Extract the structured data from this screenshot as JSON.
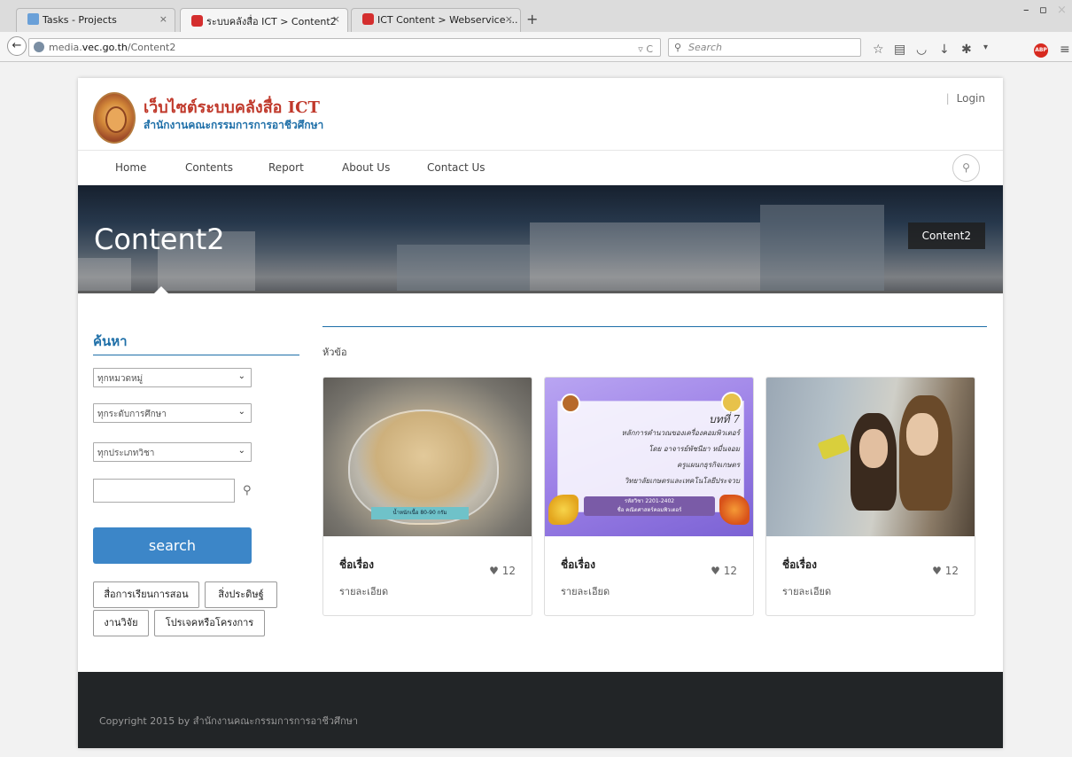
{
  "browser": {
    "tabs": [
      {
        "title": "Tasks - Projects"
      },
      {
        "title": "ระบบคลังสื่อ ICT > Content2"
      },
      {
        "title": "ICT Content > Webservice ..."
      }
    ],
    "url_prefix": "media.",
    "url_domain": "vec.go.th",
    "url_path": "/Content2",
    "search_placeholder": "Search",
    "abp_label": "ABP"
  },
  "site": {
    "title": "เว็บไซต์ระบบคลังสื่อ ICT",
    "subtitle": "สำนักงานคณะกรรมการการอาชีวศึกษา",
    "login": "Login",
    "menu": [
      "Home",
      "Contents",
      "Report",
      "About Us",
      "Contact Us"
    ],
    "hero_title": "Content2",
    "breadcrumb": "Content2"
  },
  "sidebar": {
    "title": "ค้นหา",
    "selects": [
      "ทุกหมวดหมู่",
      "ทุกระดับการศึกษา",
      "ทุกประเภทวิชา"
    ],
    "search_button": "search",
    "tags": [
      "สื่อการเรียนการสอน",
      "สิ่งประดิษฐ์",
      "งานวิจัย",
      "โปรเจคหรือโครงการ"
    ]
  },
  "content": {
    "label": "หัวข้อ",
    "cards": [
      {
        "title": "ชื่อเรื่อง",
        "likes": "12",
        "desc": "รายละเอียด",
        "image": "bowl-photo",
        "image_text": "น้ำหนักเนื้อ 80-90 กรัม"
      },
      {
        "title": "ชื่อเรื่อง",
        "likes": "12",
        "desc": "รายละเอียด",
        "image": "lesson-slide",
        "slide": {
          "chapter": "บทที่ 7",
          "line1": "หลักการคำนวณของเครื่องคอมพิวเตอร์",
          "line2": "โดย อาจารย์พัชนียา หมื่นจอม",
          "line3": "ครูแผนกธุรกิจเกษตร",
          "line4": "วิทยาลัยเกษตรและเทคโนโลยีประจวบ",
          "bar1": "รหัสวิชา 2201-2402",
          "bar2": "ชื่อ คณิตศาสตร์คอมพิวเตอร์"
        }
      },
      {
        "title": "ชื่อเรื่อง",
        "likes": "12",
        "desc": "รายละเอียด",
        "image": "selfie-photo"
      }
    ]
  },
  "footer": {
    "copyright": "Copyright 2015 by สำนักงานคณะกรรมการการอาชีวศึกษา"
  },
  "colors": {
    "accent": "#1e6fa8",
    "brand_title": "#c0392b",
    "button": "#3c86c8",
    "footer": "#222527"
  }
}
